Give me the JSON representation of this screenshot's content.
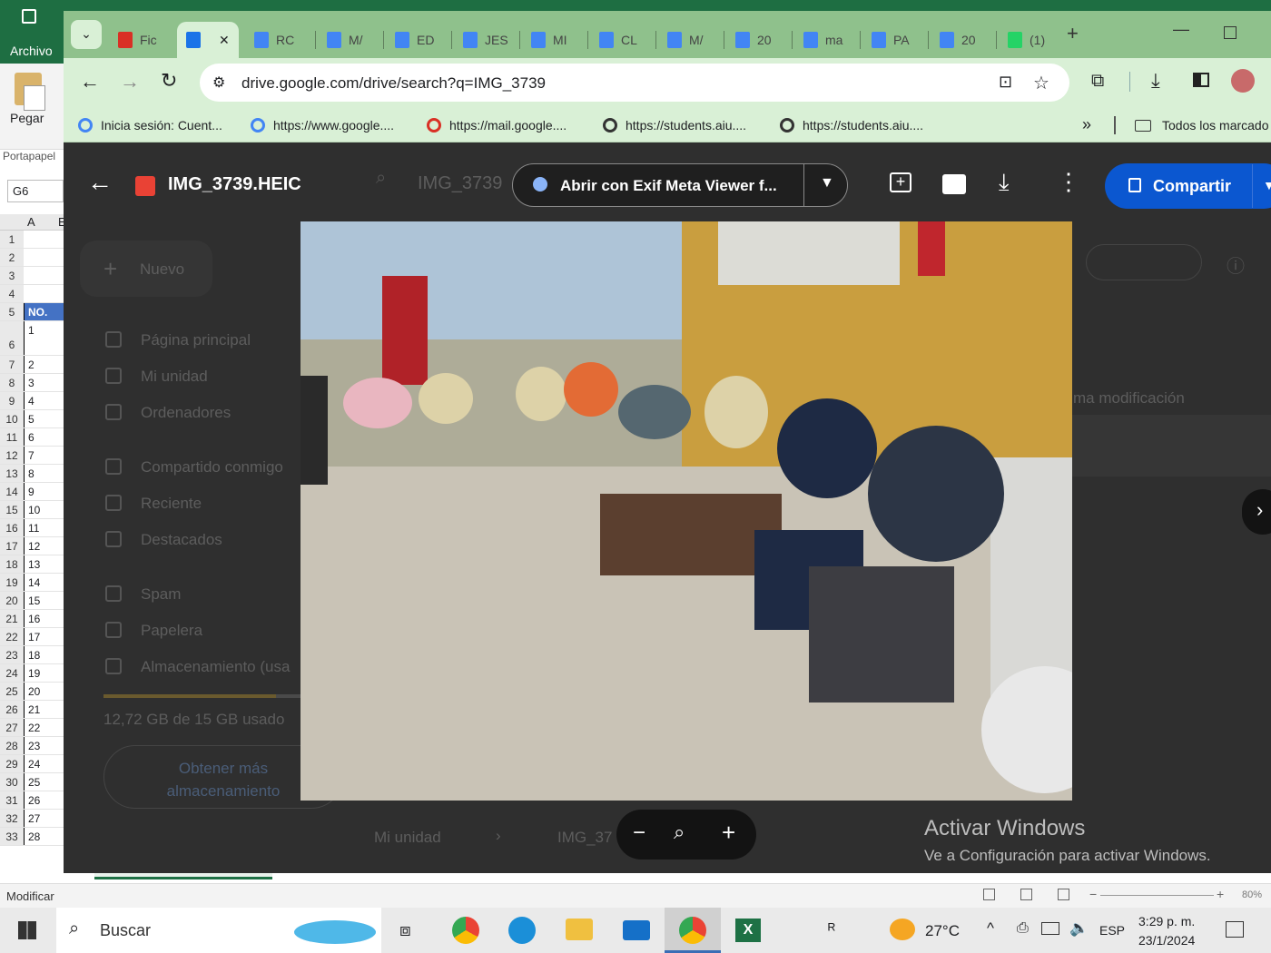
{
  "excel": {
    "file_menu": "Archivo",
    "paste_label": "Pegar",
    "clipboard_group": "Portapapel",
    "name_box": "G6",
    "col_headers": [
      "A",
      "E"
    ],
    "table_header": "NO.",
    "rows": [
      {
        "row": "1",
        "val": ""
      },
      {
        "row": "2",
        "val": ""
      },
      {
        "row": "3",
        "val": ""
      },
      {
        "row": "4",
        "val": ""
      },
      {
        "row": "5",
        "val": "NO."
      },
      {
        "row": "6",
        "val": "1"
      },
      {
        "row": "7",
        "val": "2"
      },
      {
        "row": "8",
        "val": "3"
      },
      {
        "row": "9",
        "val": "4"
      },
      {
        "row": "10",
        "val": "5"
      },
      {
        "row": "11",
        "val": "6"
      },
      {
        "row": "12",
        "val": "7"
      },
      {
        "row": "13",
        "val": "8"
      },
      {
        "row": "14",
        "val": "9"
      },
      {
        "row": "15",
        "val": "10"
      },
      {
        "row": "16",
        "val": "11"
      },
      {
        "row": "17",
        "val": "12"
      },
      {
        "row": "18",
        "val": "13"
      },
      {
        "row": "19",
        "val": "14"
      },
      {
        "row": "20",
        "val": "15"
      },
      {
        "row": "21",
        "val": "16"
      },
      {
        "row": "22",
        "val": "17"
      },
      {
        "row": "23",
        "val": "18"
      },
      {
        "row": "24",
        "val": "19"
      },
      {
        "row": "25",
        "val": "20"
      },
      {
        "row": "26",
        "val": "21"
      },
      {
        "row": "27",
        "val": "22"
      },
      {
        "row": "28",
        "val": "23"
      },
      {
        "row": "29",
        "val": "24"
      },
      {
        "row": "30",
        "val": "25"
      },
      {
        "row": "31",
        "val": "26"
      },
      {
        "row": "32",
        "val": "27"
      },
      {
        "row": "33",
        "val": "28"
      }
    ],
    "status_mode": "Modificar",
    "zoom": "80%"
  },
  "browser": {
    "tabs": [
      {
        "label": "Fic",
        "icon": "gmail-icon",
        "color": "#d93025"
      },
      {
        "label": "",
        "icon": "drive-icon",
        "color": "#1a73e8",
        "active": true
      },
      {
        "label": "RC",
        "icon": "docs-icon",
        "color": "#4285f4"
      },
      {
        "label": "M/",
        "icon": "docs-icon",
        "color": "#4285f4"
      },
      {
        "label": "ED",
        "icon": "docs-icon",
        "color": "#4285f4"
      },
      {
        "label": "JES",
        "icon": "docs-icon",
        "color": "#4285f4"
      },
      {
        "label": "MI",
        "icon": "docs-icon",
        "color": "#4285f4"
      },
      {
        "label": "CL",
        "icon": "docs-icon",
        "color": "#4285f4"
      },
      {
        "label": "M/",
        "icon": "docs-icon",
        "color": "#4285f4"
      },
      {
        "label": "20",
        "icon": "docs-icon",
        "color": "#4285f4"
      },
      {
        "label": "ma",
        "icon": "docs-icon",
        "color": "#4285f4"
      },
      {
        "label": "PA",
        "icon": "docs-icon",
        "color": "#4285f4"
      },
      {
        "label": "20",
        "icon": "docs-icon",
        "color": "#4285f4"
      },
      {
        "label": "(1)",
        "icon": "whatsapp-icon",
        "color": "#25d366"
      }
    ],
    "url": "drive.google.com/drive/search?q=IMG_3739",
    "bookmarks": [
      {
        "label": "Inicia sesión: Cuent...",
        "icon": "google-icon"
      },
      {
        "label": "https://www.google....",
        "icon": "google-icon"
      },
      {
        "label": "https://mail.google....",
        "icon": "gmail-icon"
      },
      {
        "label": "https://students.aiu....",
        "icon": "globe-icon"
      },
      {
        "label": "https://students.aiu....",
        "icon": "globe-icon"
      }
    ],
    "bookmarks_overflow": "»",
    "all_bookmarks": "Todos los marcado"
  },
  "drive": {
    "search_text": "IMG_3739",
    "new_button": "Nuevo",
    "nav": [
      "Página principal",
      "Mi unidad",
      "Ordenadores",
      "Compartido conmigo",
      "Reciente",
      "Destacados",
      "Spam",
      "Papelera",
      "Almacenamiento (usa"
    ],
    "storage_used": "12,72 GB de 15 GB usado",
    "storage_fraction": 0.848,
    "get_more": [
      "Obtener más",
      "almacenamiento"
    ],
    "column_modified": "ma modificación",
    "breadcrumb": [
      "Mi unidad",
      "IMG_37"
    ]
  },
  "viewer": {
    "filename": "IMG_3739.HEIC",
    "open_with": "Abrir con Exif Meta Viewer f...",
    "share": "Compartir"
  },
  "windows_watermark": {
    "title": "Activar Windows",
    "subtitle": "Ve a Configuración para activar Windows."
  },
  "taskbar": {
    "search_placeholder": "Buscar",
    "weather": "27°C",
    "language": "ESP",
    "time": "3:29 p. m.",
    "date": "23/1/2024"
  }
}
